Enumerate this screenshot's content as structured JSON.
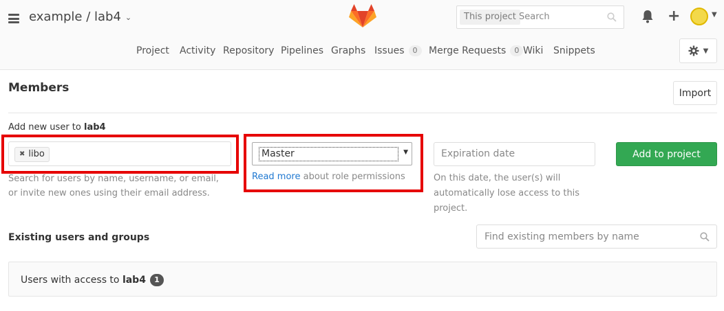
{
  "header": {
    "project_path": "example / lab4",
    "search": {
      "scope": "This project",
      "placeholder": "Search"
    }
  },
  "nav": {
    "items": [
      {
        "label": "Project"
      },
      {
        "label": "Activity"
      },
      {
        "label": "Repository"
      },
      {
        "label": "Pipelines"
      },
      {
        "label": "Graphs"
      },
      {
        "label": "Issues",
        "count": "0"
      },
      {
        "label": "Merge Requests",
        "count": "0"
      },
      {
        "label": "Wiki"
      },
      {
        "label": "Snippets"
      }
    ]
  },
  "members": {
    "title": "Members",
    "import_label": "Import",
    "add_prefix": "Add new user to ",
    "project_name": "lab4",
    "user_token": "libo",
    "user_help": "Search for users by name, username, or email, or invite new ones using their email address.",
    "role_value": "Master",
    "read_more_link": "Read more",
    "read_more_suffix": " about role permissions",
    "expiration_placeholder": "Expiration date",
    "expiration_help": "On this date, the user(s) will automatically lose access to this project.",
    "add_button": "Add to project"
  },
  "existing": {
    "title": "Existing users and groups",
    "find_placeholder": "Find existing members by name",
    "panel_prefix": "Users with access to ",
    "panel_project": "lab4",
    "count": "1"
  },
  "colors": {
    "accent_green": "#33a853",
    "highlight_red": "#e60000",
    "link_blue": "#1f78d1"
  }
}
